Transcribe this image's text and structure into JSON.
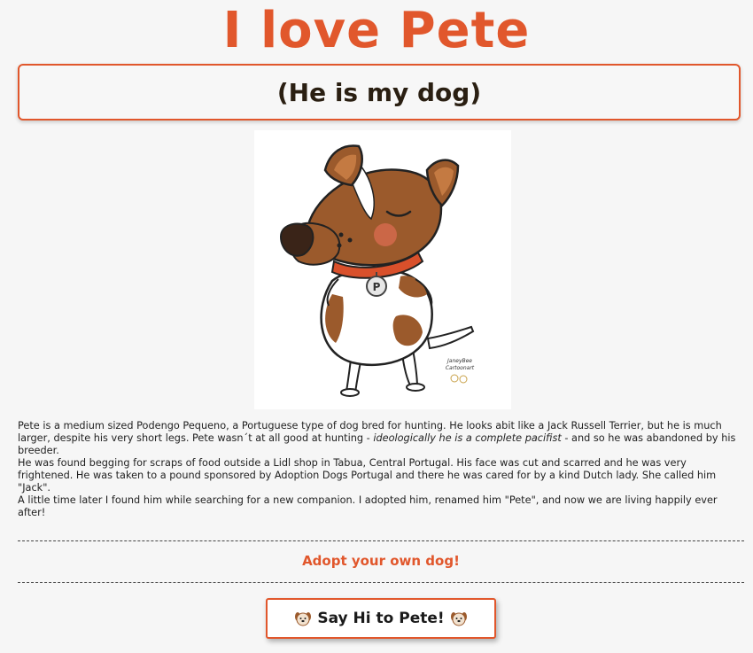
{
  "header": {
    "title": "I love Pete",
    "subtitle": "(He is my dog)"
  },
  "image": {
    "icon": "cartoon-dog-illustration",
    "tag_letter": "P",
    "artist_signature": "JaneyBee Cartoonart"
  },
  "story": {
    "p1_before_em": "Pete is a medium sized Podengo Pequeno, a Portuguese type of dog bred for hunting. He looks abit like a Jack Russell Terrier, but he is much larger, despite his very short legs. Pete wasn´t at all good at hunting - ",
    "p1_em": "ideologically he is a complete pacifist",
    "p1_after_em": " - and so he was abandoned by his breeder.",
    "p2": "He was found begging for scraps of food outside a Lidl shop in Tabua, Central Portugal. His face was cut and scarred and he was very frightened. He was taken to a pound sponsored by Adoption Dogs Portugal and there he was cared for by a kind Dutch lady. She called him \"Jack\".",
    "p3": "A little time later I found him while searching for a new companion. I adopted him, renamed him \"Pete\", and now we are living happily ever after!"
  },
  "adopt_link": {
    "label": "Adopt your own dog!"
  },
  "hi_button": {
    "label": "Say Hi to Pete!",
    "icon": "dog-face-icon"
  },
  "colors": {
    "accent": "#e1572c",
    "background": "#f6f6f6",
    "subtitle_text": "#2a1f12"
  }
}
